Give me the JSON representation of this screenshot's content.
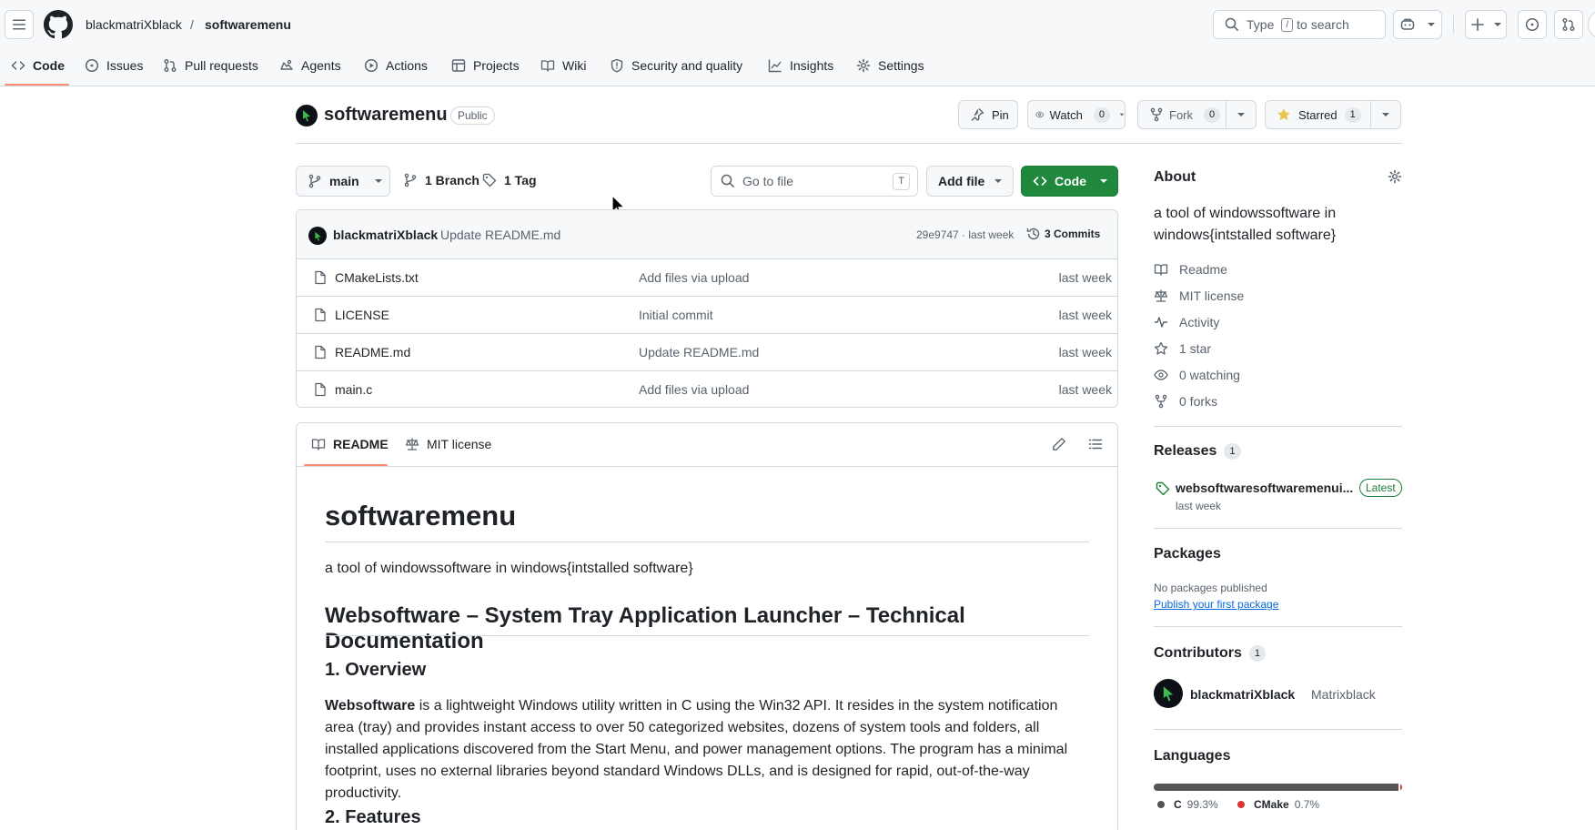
{
  "header": {
    "owner": "blackmatriXblack",
    "separator": "/",
    "repo": "softwaremenu",
    "search_prefix": "Type",
    "search_key": "/",
    "search_suffix": "to search"
  },
  "tabs": [
    {
      "label": "Code",
      "icon": "code-icon"
    },
    {
      "label": "Issues",
      "icon": "issue-icon"
    },
    {
      "label": "Pull requests",
      "icon": "pull-request-icon"
    },
    {
      "label": "Agents",
      "icon": "agent-icon"
    },
    {
      "label": "Actions",
      "icon": "play-icon"
    },
    {
      "label": "Projects",
      "icon": "table-icon"
    },
    {
      "label": "Wiki",
      "icon": "book-icon"
    },
    {
      "label": "Security and quality",
      "icon": "shield-icon"
    },
    {
      "label": "Insights",
      "icon": "graph-icon"
    },
    {
      "label": "Settings",
      "icon": "gear-icon"
    }
  ],
  "repo_header": {
    "name": "softwaremenu",
    "visibility": "Public",
    "pin_label": "Pin",
    "watch_label": "Watch",
    "watch_count": "0",
    "fork_label": "Fork",
    "fork_count": "0",
    "star_label": "Starred",
    "star_count": "1"
  },
  "toolbar": {
    "branch": "main",
    "branches": "1 Branch",
    "tags": "1 Tag",
    "goto_placeholder": "Go to file",
    "goto_key": "T",
    "add_file": "Add file",
    "code": "Code"
  },
  "commit": {
    "author": "blackmatriXblack",
    "message": "Update README.md",
    "hash_time": "29e9747 · last week",
    "commits": "3 Commits"
  },
  "files": [
    {
      "name": "CMakeLists.txt",
      "message": "Add files via upload",
      "date": "last week"
    },
    {
      "name": "LICENSE",
      "message": "Initial commit",
      "date": "last week"
    },
    {
      "name": "README.md",
      "message": "Update README.md",
      "date": "last week"
    },
    {
      "name": "main.c",
      "message": "Add files via upload",
      "date": "last week"
    }
  ],
  "readme": {
    "tab_readme": "README",
    "tab_license": "MIT license",
    "title": "softwaremenu",
    "intro": "a tool of windowssoftware in windows{intstalled software}",
    "h2": "Websoftware – System Tray Application Launcher – Technical Documentation",
    "h3_overview": "1. Overview",
    "overview_bold": "Websoftware",
    "overview_text": " is a lightweight Windows utility written in C using the Win32 API. It resides in the system notification area (tray) and provides instant access to over 50 categorized websites, dozens of system tools and folders, all installed applications discovered from the Start Menu, and power management options. The program has a minimal footprint, uses no external libraries beyond standard Windows DLLs, and is designed for rapid, out-of-the-way productivity.",
    "h3_features": "2. Features"
  },
  "about": {
    "title": "About",
    "description": "a tool of windowssoftware in windows{intstalled software}",
    "readme": "Readme",
    "license": "MIT license",
    "activity": "Activity",
    "stars": "1 star",
    "watching": "0 watching",
    "forks": "0 forks"
  },
  "releases": {
    "title": "Releases",
    "count": "1",
    "name": "websoftwaresoftwaremenui...",
    "latest": "Latest",
    "date": "last week"
  },
  "packages": {
    "title": "Packages",
    "none": "No packages published",
    "publish": "Publish your first package"
  },
  "contributors": {
    "title": "Contributors",
    "count": "1",
    "login": "blackmatriXblack",
    "name": "Matrixblack"
  },
  "languages": {
    "title": "Languages",
    "items": [
      {
        "name": "C",
        "percent": "99.3%",
        "value": 99.3,
        "color": "#555555"
      },
      {
        "name": "CMake",
        "percent": "0.7%",
        "value": 0.7,
        "color": "#DA3434"
      }
    ]
  },
  "colors": {
    "primary_green": "#1f883d",
    "accent_orange": "#fd8c73",
    "link_blue": "#0969da",
    "star_yellow": "#eac54f"
  }
}
